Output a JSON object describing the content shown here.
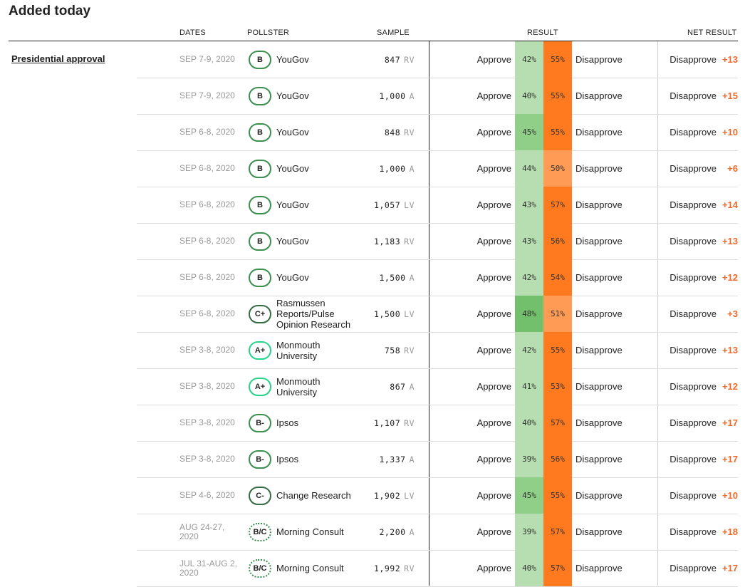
{
  "page": {
    "title": "Added today",
    "section": "Presidential approval"
  },
  "columns": {
    "dates": "DATES",
    "pollster": "POLLSTER",
    "sample": "SAMPLE",
    "result": "RESULT",
    "net_result": "NET RESULT"
  },
  "colors": {
    "approve_light": "#b6deb0",
    "approve_mid": "#8fcf87",
    "approve_dark": "#73c06c",
    "disapprove_strong": "#ff7a1f",
    "disapprove_light": "#ff9b55",
    "net_accent": "#f06a2b"
  },
  "rows": [
    {
      "dates": "SEP 7-9, 2020",
      "grade": "B",
      "grade_style": "g-b",
      "pollster": "YouGov",
      "sample_n": "847",
      "sample_pop": "RV",
      "approve_label": "Approve",
      "approve_pct": "42%",
      "disapprove_pct": "55%",
      "disapprove_label": "Disapprove",
      "net_label": "Disapprove",
      "net_value": "+13",
      "approve_shade": "light",
      "disapprove_shade": "strong"
    },
    {
      "dates": "SEP 7-9, 2020",
      "grade": "B",
      "grade_style": "g-b",
      "pollster": "YouGov",
      "sample_n": "1,000",
      "sample_pop": "A",
      "approve_label": "Approve",
      "approve_pct": "40%",
      "disapprove_pct": "55%",
      "disapprove_label": "Disapprove",
      "net_label": "Disapprove",
      "net_value": "+15",
      "approve_shade": "light",
      "disapprove_shade": "strong"
    },
    {
      "dates": "SEP 6-8, 2020",
      "grade": "B",
      "grade_style": "g-b",
      "pollster": "YouGov",
      "sample_n": "848",
      "sample_pop": "RV",
      "approve_label": "Approve",
      "approve_pct": "45%",
      "disapprove_pct": "55%",
      "disapprove_label": "Disapprove",
      "net_label": "Disapprove",
      "net_value": "+10",
      "approve_shade": "mid",
      "disapprove_shade": "strong"
    },
    {
      "dates": "SEP 6-8, 2020",
      "grade": "B",
      "grade_style": "g-b",
      "pollster": "YouGov",
      "sample_n": "1,000",
      "sample_pop": "A",
      "approve_label": "Approve",
      "approve_pct": "44%",
      "disapprove_pct": "50%",
      "disapprove_label": "Disapprove",
      "net_label": "Disapprove",
      "net_value": "+6",
      "approve_shade": "light",
      "disapprove_shade": "light"
    },
    {
      "dates": "SEP 6-8, 2020",
      "grade": "B",
      "grade_style": "g-b",
      "pollster": "YouGov",
      "sample_n": "1,057",
      "sample_pop": "LV",
      "approve_label": "Approve",
      "approve_pct": "43%",
      "disapprove_pct": "57%",
      "disapprove_label": "Disapprove",
      "net_label": "Disapprove",
      "net_value": "+14",
      "approve_shade": "light",
      "disapprove_shade": "strong"
    },
    {
      "dates": "SEP 6-8, 2020",
      "grade": "B",
      "grade_style": "g-b",
      "pollster": "YouGov",
      "sample_n": "1,183",
      "sample_pop": "RV",
      "approve_label": "Approve",
      "approve_pct": "43%",
      "disapprove_pct": "56%",
      "disapprove_label": "Disapprove",
      "net_label": "Disapprove",
      "net_value": "+13",
      "approve_shade": "light",
      "disapprove_shade": "strong"
    },
    {
      "dates": "SEP 6-8, 2020",
      "grade": "B",
      "grade_style": "g-b",
      "pollster": "YouGov",
      "sample_n": "1,500",
      "sample_pop": "A",
      "approve_label": "Approve",
      "approve_pct": "42%",
      "disapprove_pct": "54%",
      "disapprove_label": "Disapprove",
      "net_label": "Disapprove",
      "net_value": "+12",
      "approve_shade": "light",
      "disapprove_shade": "strong"
    },
    {
      "dates": "SEP 6-8, 2020",
      "grade": "C+",
      "grade_style": "g-cplus",
      "pollster": "Rasmussen Reports/Pulse Opinion Research",
      "sample_n": "1,500",
      "sample_pop": "LV",
      "approve_label": "Approve",
      "approve_pct": "48%",
      "disapprove_pct": "51%",
      "disapprove_label": "Disapprove",
      "net_label": "Disapprove",
      "net_value": "+3",
      "approve_shade": "dark",
      "disapprove_shade": "light"
    },
    {
      "dates": "SEP 3-8, 2020",
      "grade": "A+",
      "grade_style": "g-aplus",
      "pollster": "Monmouth University",
      "sample_n": "758",
      "sample_pop": "RV",
      "approve_label": "Approve",
      "approve_pct": "42%",
      "disapprove_pct": "55%",
      "disapprove_label": "Disapprove",
      "net_label": "Disapprove",
      "net_value": "+13",
      "approve_shade": "light",
      "disapprove_shade": "strong"
    },
    {
      "dates": "SEP 3-8, 2020",
      "grade": "A+",
      "grade_style": "g-aplus",
      "pollster": "Monmouth University",
      "sample_n": "867",
      "sample_pop": "A",
      "approve_label": "Approve",
      "approve_pct": "41%",
      "disapprove_pct": "53%",
      "disapprove_label": "Disapprove",
      "net_label": "Disapprove",
      "net_value": "+12",
      "approve_shade": "light",
      "disapprove_shade": "strong"
    },
    {
      "dates": "SEP 3-8, 2020",
      "grade": "B-",
      "grade_style": "g-b",
      "pollster": "Ipsos",
      "sample_n": "1,107",
      "sample_pop": "RV",
      "approve_label": "Approve",
      "approve_pct": "40%",
      "disapprove_pct": "57%",
      "disapprove_label": "Disapprove",
      "net_label": "Disapprove",
      "net_value": "+17",
      "approve_shade": "light",
      "disapprove_shade": "strong"
    },
    {
      "dates": "SEP 3-8, 2020",
      "grade": "B-",
      "grade_style": "g-b",
      "pollster": "Ipsos",
      "sample_n": "1,337",
      "sample_pop": "A",
      "approve_label": "Approve",
      "approve_pct": "39%",
      "disapprove_pct": "56%",
      "disapprove_label": "Disapprove",
      "net_label": "Disapprove",
      "net_value": "+17",
      "approve_shade": "light",
      "disapprove_shade": "strong"
    },
    {
      "dates": "SEP 4-6, 2020",
      "grade": "C-",
      "grade_style": "g-cminus",
      "pollster": "Change Research",
      "sample_n": "1,902",
      "sample_pop": "LV",
      "approve_label": "Approve",
      "approve_pct": "45%",
      "disapprove_pct": "55%",
      "disapprove_label": "Disapprove",
      "net_label": "Disapprove",
      "net_value": "+10",
      "approve_shade": "mid",
      "disapprove_shade": "strong"
    },
    {
      "dates": "AUG 24-27, 2020",
      "grade": "B/C",
      "grade_style": "g-bc",
      "pollster": "Morning Consult",
      "sample_n": "2,200",
      "sample_pop": "A",
      "approve_label": "Approve",
      "approve_pct": "39%",
      "disapprove_pct": "57%",
      "disapprove_label": "Disapprove",
      "net_label": "Disapprove",
      "net_value": "+18",
      "approve_shade": "light",
      "disapprove_shade": "strong"
    },
    {
      "dates": "JUL 31-AUG 2, 2020",
      "grade": "B/C",
      "grade_style": "g-bc",
      "pollster": "Morning Consult",
      "sample_n": "1,992",
      "sample_pop": "RV",
      "approve_label": "Approve",
      "approve_pct": "40%",
      "disapprove_pct": "57%",
      "disapprove_label": "Disapprove",
      "net_label": "Disapprove",
      "net_value": "+17",
      "approve_shade": "light",
      "disapprove_shade": "strong"
    }
  ]
}
